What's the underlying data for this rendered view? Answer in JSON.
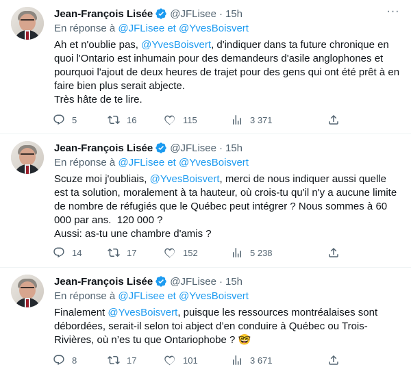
{
  "tweets": [
    {
      "name": "Jean-François Lisée",
      "handle": "@JFLisee",
      "dot": "·",
      "time": "15h",
      "reply_prefix": "En réponse à",
      "reply_user1": "@JFLisee",
      "reply_et": "et",
      "reply_user2": "@YvesBoisvert",
      "body": {
        "part1": "Ah et n'oublie pas, ",
        "mention": "@YvesBoisvert",
        "part2": ", d'indiquer dans ta future chronique en quoi l'Ontario est inhumain pour des demandeurs d'asile anglophones et pourquoi l'ajout de deux heures de trajet pour des gens qui ont été prêt à en faire bien plus serait abjecte.\nTrès hâte de te lire."
      },
      "replies": "5",
      "retweets": "16",
      "likes": "115",
      "views": "3 371"
    },
    {
      "name": "Jean-François Lisée",
      "handle": "@JFLisee",
      "dot": "·",
      "time": "15h",
      "reply_prefix": "En réponse à",
      "reply_user1": "@JFLisee",
      "reply_et": "et",
      "reply_user2": "@YvesBoisvert",
      "body": {
        "part1": "Scuze moi j'oubliais, ",
        "mention": "@YvesBoisvert",
        "part2": ", merci de nous indiquer aussi quelle est ta solution, moralement à ta hauteur, où crois-tu qu'il n'y a aucune limite de nombre de réfugiés que le Québec peut intégrer ? Nous sommes à 60 000 par ans.  120 000 ?\nAussi: as-tu une chambre d'amis ?"
      },
      "replies": "14",
      "retweets": "17",
      "likes": "152",
      "views": "5 238"
    },
    {
      "name": "Jean-François Lisée",
      "handle": "@JFLisee",
      "dot": "·",
      "time": "15h",
      "reply_prefix": "En réponse à",
      "reply_user1": "@JFLisee",
      "reply_et": "et",
      "reply_user2": "@YvesBoisvert",
      "body": {
        "part1": "Finalement ",
        "mention": "@YvesBoisvert",
        "part2": ", puisque les ressources montréalaises sont débordées, serait-il selon toi abject d’en conduire à Québec ou Trois-Rivières, où n’es tu que Ontariophobe ? 🤓"
      },
      "replies": "8",
      "retweets": "17",
      "likes": "101",
      "views": "3 671"
    }
  ],
  "colors": {
    "link": "#1d9bf0",
    "secondary": "#536471",
    "text": "#0f1419",
    "verified": "#1d9bf0"
  },
  "icons": [
    "verified-badge-icon",
    "more-icon",
    "reply-icon",
    "retweet-icon",
    "like-icon",
    "views-icon",
    "share-icon"
  ]
}
